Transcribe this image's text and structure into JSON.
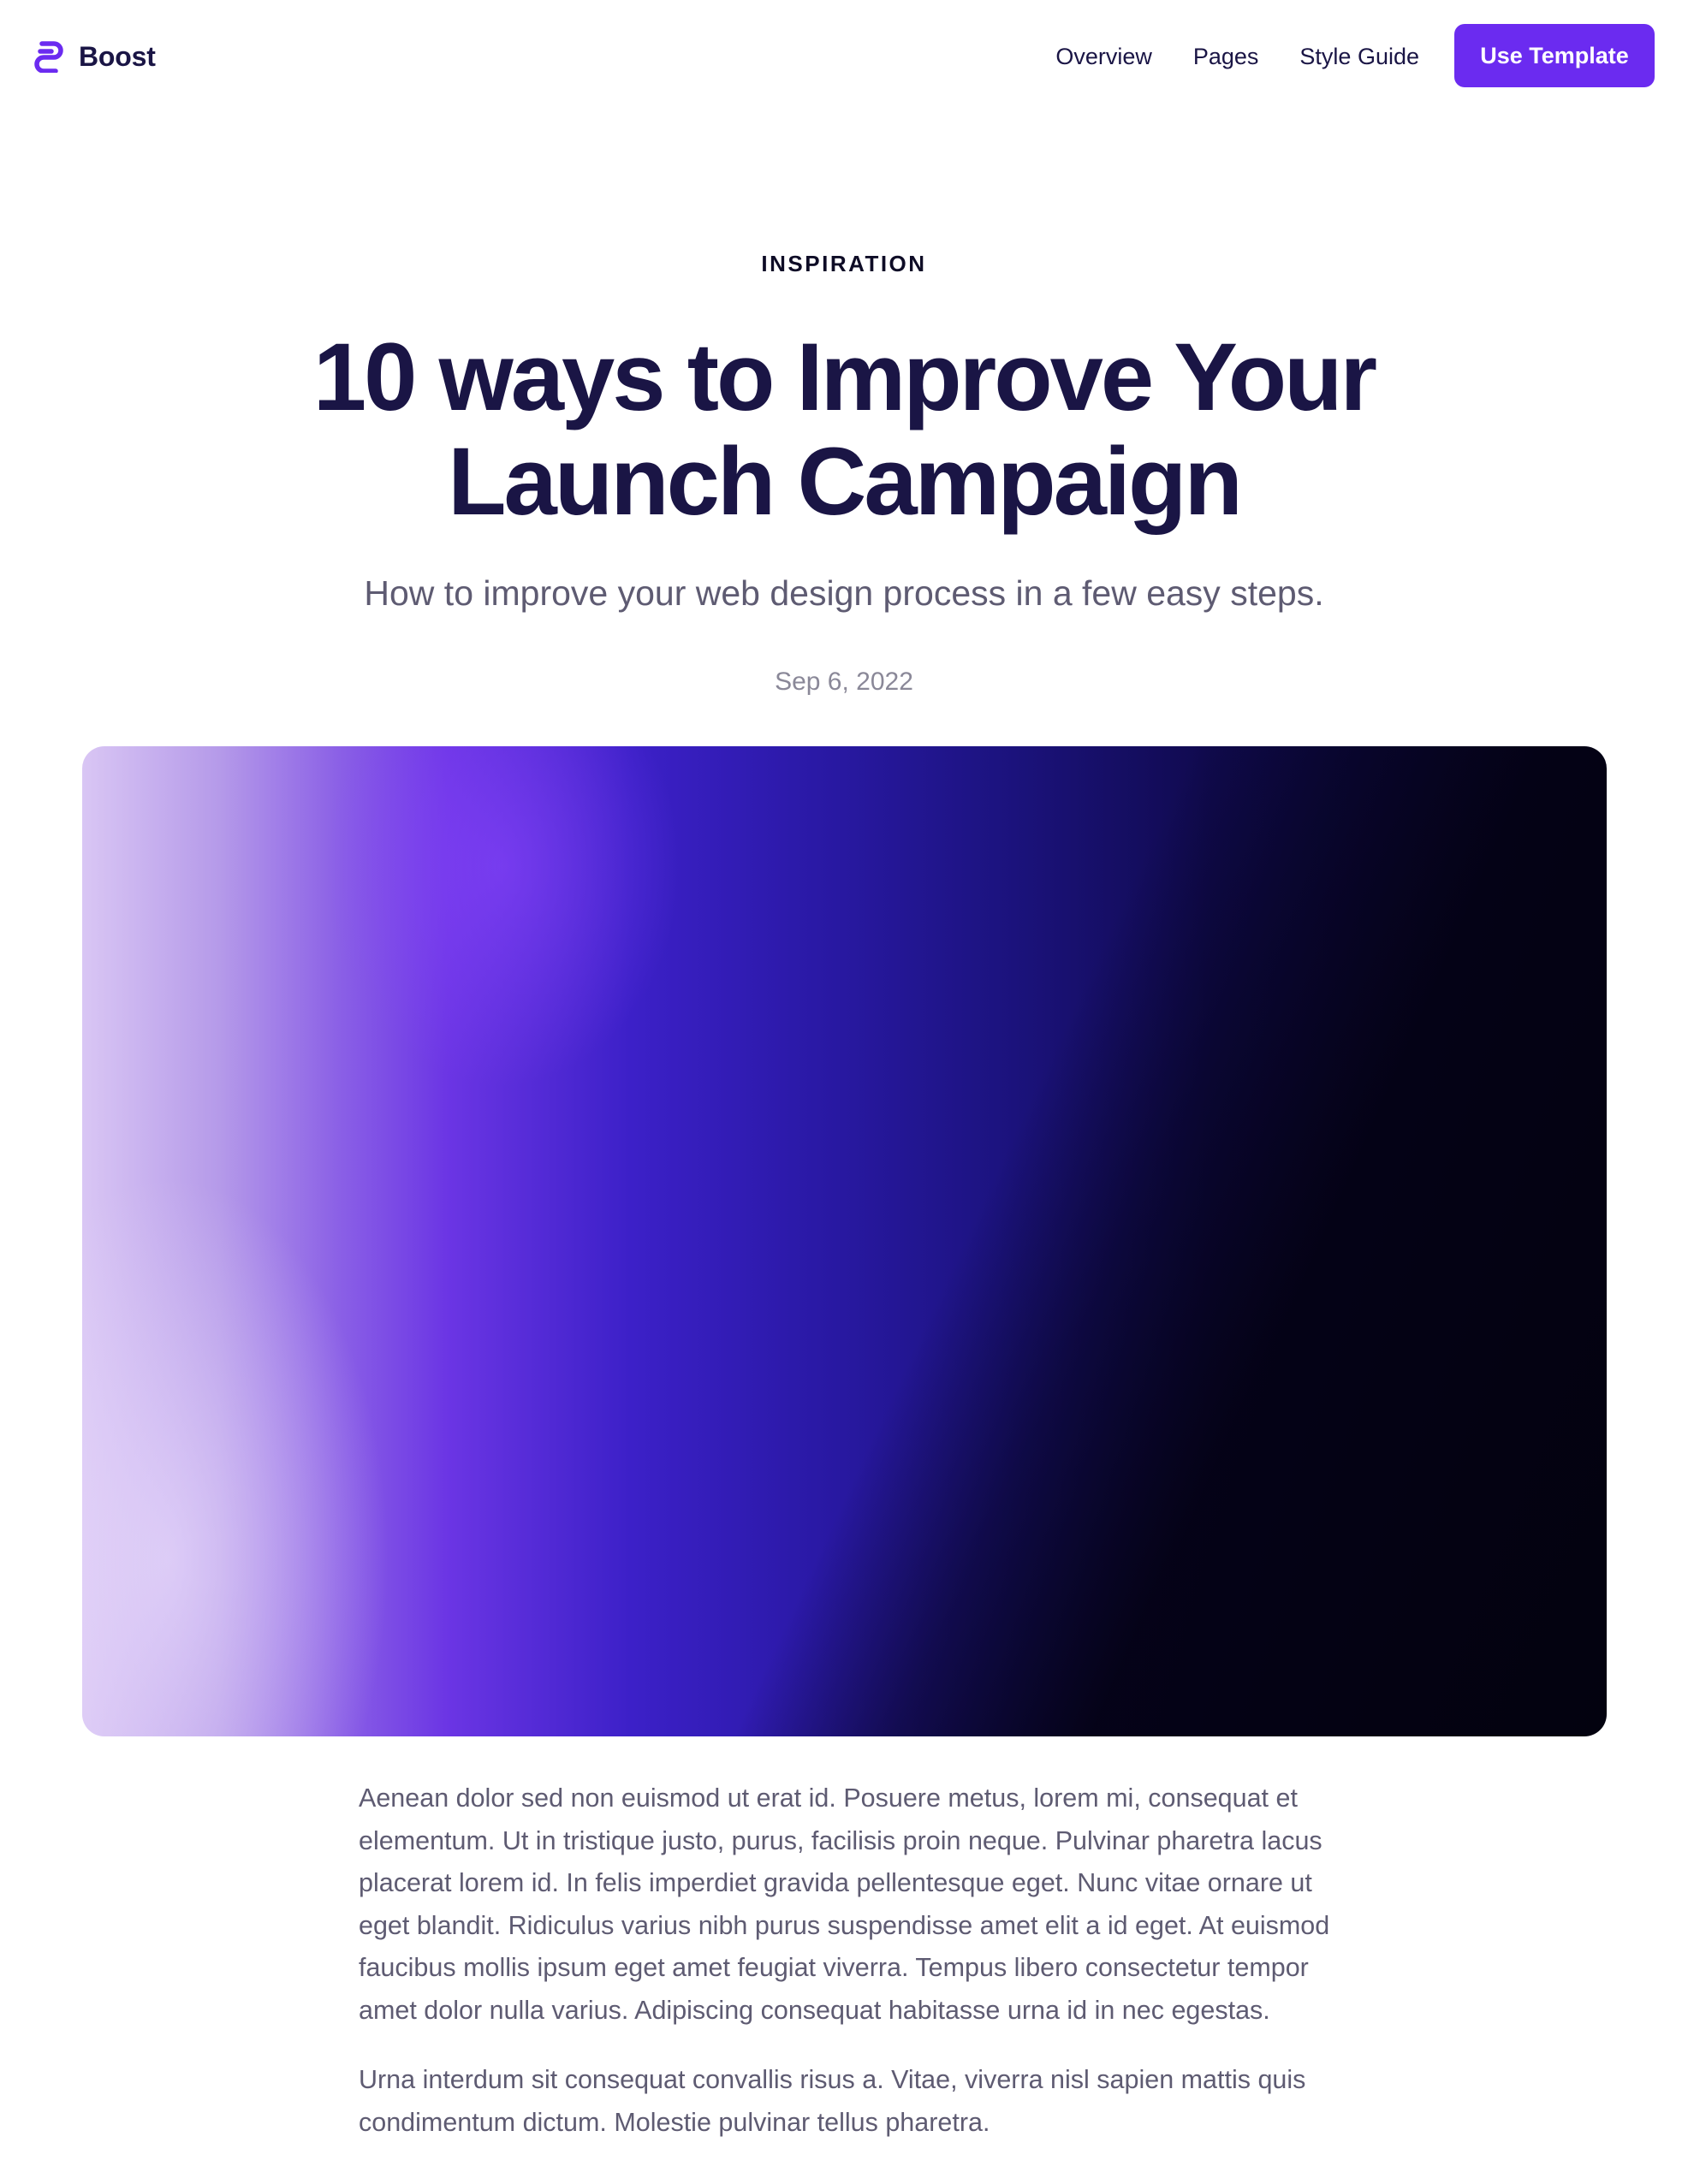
{
  "nav": {
    "brand": "Boost",
    "links": [
      {
        "label": "Overview"
      },
      {
        "label": "Pages"
      },
      {
        "label": "Style Guide"
      }
    ],
    "cta_label": "Use Template"
  },
  "post": {
    "category": "INSPIRATION",
    "title_line1": "10 ways to Improve Your",
    "title_line2": "Launch Campaign",
    "subtitle": "How to improve your web design process in a few easy steps.",
    "date": "Sep 6, 2022",
    "paragraphs": [
      "Aenean dolor sed non euismod ut erat id. Posuere metus, lorem mi, consequat et elementum. Ut in tristique justo, purus, facilisis proin neque. Pulvinar pharetra lacus placerat lorem id. In felis imperdiet gravida pellentesque eget. Nunc vitae ornare ut eget blandit. Ridiculus varius nibh purus suspendisse amet elit a id eget. At euismod faucibus mollis ipsum eget amet feugiat viverra. Tempus libero consectetur tempor amet dolor nulla varius. Adipiscing consequat habitasse urna id in nec egestas.",
      "Urna interdum sit consequat convallis risus a. Vitae, viverra nisl sapien mattis quis condimentum dictum. Molestie pulvinar tellus pharetra."
    ]
  },
  "colors": {
    "accent": "#6b2bf0",
    "heading": "#1a1545",
    "body_text": "#5e5b72"
  },
  "icons": {
    "brand": "boost-logo-icon"
  }
}
